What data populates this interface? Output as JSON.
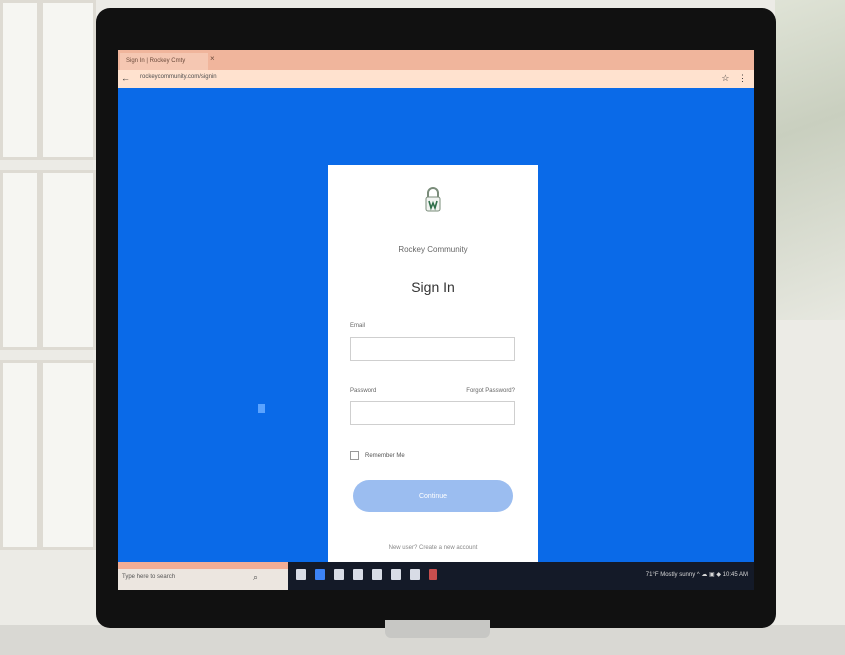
{
  "browser": {
    "tab_title": "Sign In | Rockey Cmty",
    "tab_close": "×",
    "url": "rockeycommunity.com/signin",
    "back": "←",
    "address_icons": "☆ ⋮"
  },
  "signin": {
    "org_name": "Rockey Community",
    "title": "Sign In",
    "email_label": "Email",
    "password_label": "Password",
    "forgot_label": "Forgot Password?",
    "remember_label": "Remember Me",
    "submit_label": "Continue",
    "footer_link": "New user? Create a new account"
  },
  "taskbar": {
    "search_text": "Type here to search",
    "search_icon": "⌕",
    "tray_text": "71°F Mostly sunny  ^ ☁ ▣ ◆ 10:45 AM"
  },
  "colors": {
    "background": "#0a6ae8",
    "card": "#ffffff",
    "button": "#9bbdf0",
    "taskbar": "#141a28",
    "tab": "#f0b59c"
  }
}
